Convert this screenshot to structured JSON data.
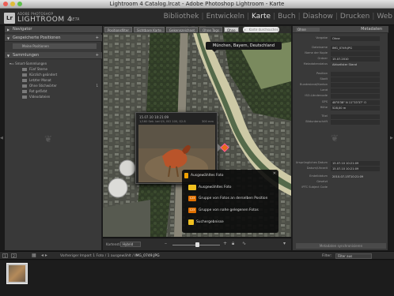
{
  "window": {
    "title": "Lightroom 4 Catalog.lrcat - Adobe Photoshop Lightroom - Karte"
  },
  "brand": {
    "line1": "ADOBE PHOTOSHOP",
    "line2": "LIGHTROOM 4",
    "line3": "BETA",
    "logo": "Lr"
  },
  "modules": [
    "Bibliothek",
    "Entwickeln",
    "Karte",
    "Buch",
    "Diashow",
    "Drucken",
    "Web"
  ],
  "active_module": "Karte",
  "left_panel": {
    "navigator": "Navigator",
    "saved_locations": "Gespeicherte Positionen",
    "my_positions": "Meine Positionen",
    "collections": "Sammlungen",
    "collection_set": "Smart-Sammlungen",
    "collection_items": [
      {
        "label": "Fünf Sterne",
        "count": ""
      },
      {
        "label": "Kürzlich geändert",
        "count": ""
      },
      {
        "label": "Letzter Monat",
        "count": ""
      },
      {
        "label": "Ohne Stichwörter",
        "count": "1"
      },
      {
        "label": "Rot gefärbt",
        "count": ""
      },
      {
        "label": "Videodateien",
        "count": ""
      }
    ]
  },
  "map": {
    "filter_buttons": [
      "Positionsfilter",
      "Sichtbare Karte",
      "Gekennzeichnet",
      "Ohne Tags",
      "Ohne"
    ],
    "active_filter": "Ohne",
    "search_placeholder": "Karte durchsuchen",
    "location_label": "München, Bayern, Deutschland",
    "popup": {
      "date": "15.07.10 10:21:09",
      "meta": "1/160 Sek. bei f/4, ISO 100, f/2.8",
      "size": "300 mm"
    },
    "legend": {
      "items": [
        {
          "label": "Ausgewähltes Foto",
          "icon": "selected-photo-marker",
          "color": "#f0a000"
        },
        {
          "label": "Ausgewähltes Foto",
          "icon": "photo-marker",
          "color": "#f0c020"
        },
        {
          "label": "Gruppe von Fotos an derselben Position",
          "icon": "group-same-position-marker",
          "color": "#e07000"
        },
        {
          "label": "Gruppe von nahe gelegenen Fotos",
          "icon": "group-nearby-marker",
          "color": "#e07000"
        },
        {
          "label": "Suchergebnisse",
          "icon": "search-result-marker",
          "color": "#f0c020"
        }
      ],
      "count_label": "123",
      "count_label2": "15"
    }
  },
  "toolbar": {
    "map_style_label": "Kartenstil:",
    "map_style_value": "Hybrid"
  },
  "right_panel": {
    "preset_label": "Ohne",
    "title": "Metadaten",
    "rows": [
      {
        "key": "Vorgabe",
        "value": "Ohne"
      },
      {
        "key": "Dateiname",
        "value": "IMG_0749.JPG"
      },
      {
        "key": "Name der Kopie",
        "value": ""
      },
      {
        "key": "Ordner",
        "value": "15.07.2010"
      },
      {
        "key": "Metadatenstatus",
        "value": "Aktuellster Stand"
      },
      {
        "key": "Position",
        "value": ""
      },
      {
        "key": "Stadt",
        "value": ""
      },
      {
        "key": "Bundesland/Kanton",
        "value": ""
      },
      {
        "key": "Land",
        "value": ""
      },
      {
        "key": "ISO-Ländercode",
        "value": ""
      },
      {
        "key": "GPS",
        "value": "48°8'38\" N 11°33'37\" O"
      },
      {
        "key": "Höhe",
        "value": "528,00 m"
      },
      {
        "key": "Titel",
        "value": ""
      },
      {
        "key": "Bildunterschrift",
        "value": ""
      },
      {
        "key": "Ursprüngliches Datum",
        "value": "15.07.10 10:21:09"
      },
      {
        "key": "Datum/Uhrzeit",
        "value": "15.07.10 10:21:09"
      },
      {
        "key": "Erstelldatum",
        "value": "2010-07-15T10:21:09"
      },
      {
        "key": "Gesetzt",
        "value": ""
      },
      {
        "key": "IPTC Subject Code",
        "value": ""
      }
    ],
    "footer": "Metadaten synchronisieren"
  },
  "filmstrip_bar": {
    "nums": [
      "1",
      "2"
    ],
    "source": "Vorheriger Import",
    "info": "1 Foto / 1 ausgewählt /",
    "file": "IMG_0749.JPG",
    "filter_label": "Filter:",
    "filter_value": "Filter aus"
  },
  "colors": {
    "accent": "#e76f1a",
    "panel": "#393939",
    "header": "#2a2a2a"
  }
}
